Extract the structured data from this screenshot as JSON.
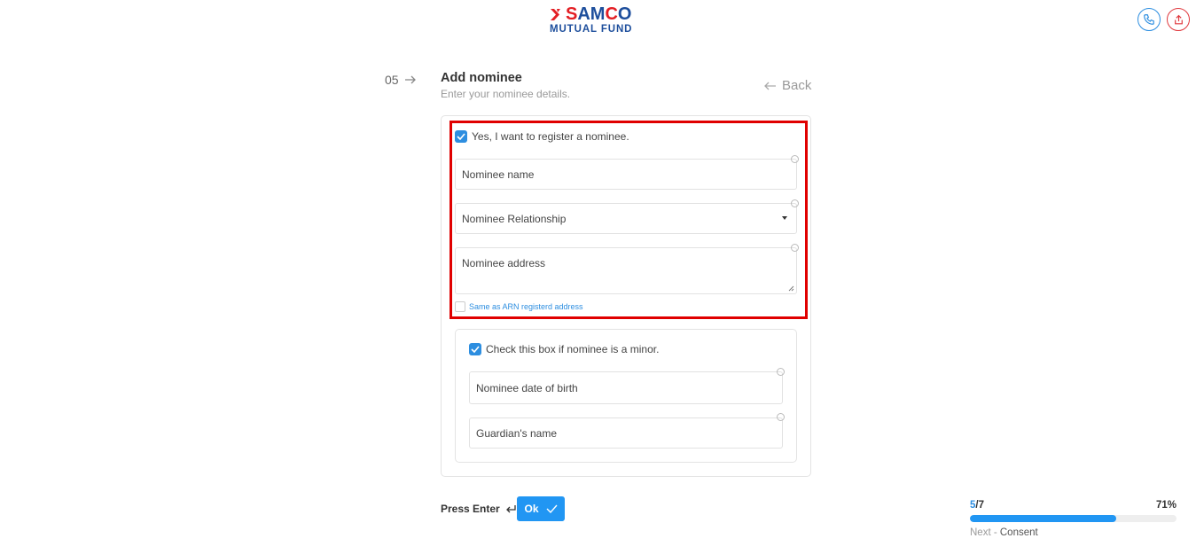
{
  "brand": {
    "word_red": "S",
    "word_blue_1": "AM",
    "word_red_2": "C",
    "word_blue_2": "O",
    "sub": "MUTUAL FUND",
    "colors": {
      "red": "#e31e24",
      "blue": "#1d4e9c"
    }
  },
  "header_icons": [
    "phone-icon",
    "share-icon"
  ],
  "question": {
    "number": "05",
    "title": "Add nominee",
    "subtitle": "Enter your nominee details.",
    "back_label": "Back"
  },
  "form": {
    "register_nominee_label": "Yes, I want to register a nominee.",
    "register_nominee_checked": true,
    "nominee_name_placeholder": "Nominee name",
    "nominee_relationship_selected": "Nominee Relationship",
    "nominee_address_placeholder": "Nominee address",
    "same_as_arn_label": "Same as ARN registerd address",
    "same_as_arn_checked": false,
    "minor_label": "Check this box if nominee is a minor.",
    "minor_checked": true,
    "nominee_dob_placeholder": "Nominee date of birth",
    "guardian_name_placeholder": "Guardian's name"
  },
  "footer": {
    "press_enter_label": "Press Enter",
    "ok_label": "Ok",
    "progress_current": "5",
    "progress_total": "/7",
    "progress_percent_label": "71%",
    "progress_fraction": 0.71,
    "next_prefix": "Next - ",
    "next_step": "Consent"
  },
  "colors": {
    "accent": "#2196f3",
    "highlight": "#e00000"
  }
}
